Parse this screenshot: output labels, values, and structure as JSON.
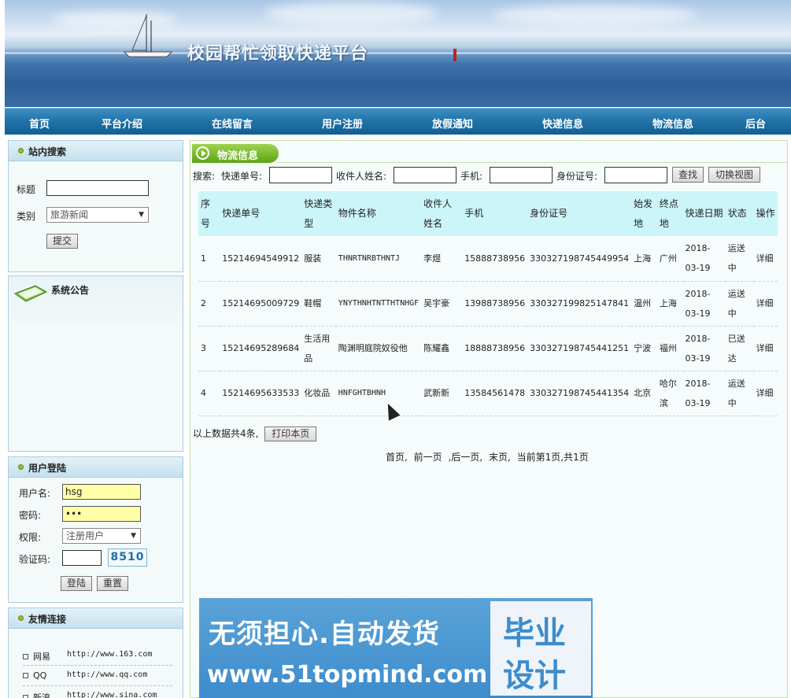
{
  "banner": {
    "title": "校园帮忙领取快递平台"
  },
  "nav": {
    "items": [
      "首页",
      "平台介绍",
      "在线留言",
      "用户注册",
      "放假通知",
      "快递信息",
      "物流信息",
      "后台"
    ]
  },
  "site_search": {
    "title": "站内搜索",
    "title_label": "标题",
    "title_value": "",
    "category_label": "类别",
    "category_value": "旅游新闻",
    "submit_label": "提交"
  },
  "announcement": {
    "title": "系统公告"
  },
  "login": {
    "title": "用户登陆",
    "username_label": "用户名:",
    "username_value": "hsg",
    "password_label": "密码:",
    "password_value": "•••",
    "role_label": "权限:",
    "role_value": "注册用户",
    "captcha_label": "验证码:",
    "captcha_value": "",
    "captcha_code": "8510",
    "login_button": "登陆",
    "reset_button": "重置"
  },
  "links": {
    "title": "友情连接",
    "items": [
      {
        "name": "网易",
        "url": "http://www.163.com"
      },
      {
        "name": "QQ",
        "url": "http://www.qq.com"
      },
      {
        "name": "新浪",
        "url": "http://www.sina.com"
      }
    ]
  },
  "main": {
    "title": "物流信息",
    "search": {
      "prefix": "搜索:",
      "tracking_label": "快递单号:",
      "recipient_label": "收件人姓名:",
      "phone_label": "手机:",
      "idcard_label": "身份证号:",
      "find_button": "查找",
      "switch_button": "切换视图"
    },
    "table": {
      "headers": [
        "序号",
        "快递单号",
        "快递类型",
        "物件名称",
        "收件人姓名",
        "手机",
        "身份证号",
        "始发地",
        "终点地",
        "快递日期",
        "状态",
        "操作"
      ],
      "rows": [
        [
          "1",
          "15214694549912",
          "服装",
          "THNRTNRBTHNTJ",
          "李煜",
          "15888738956",
          "330327198745449954",
          "上海",
          "广州",
          "2018-03-19",
          "运送中",
          "详细"
        ],
        [
          "2",
          "15214695009729",
          "鞋帽",
          "YNYTHNHTNTTHTNHGF",
          "吴宇豪",
          "13988738956",
          "330327199825147841",
          "温州",
          "上海",
          "2018-03-19",
          "运送中",
          "详细"
        ],
        [
          "3",
          "15214695289684",
          "生活用品",
          "陶渊明庭院奴役他",
          "陈耀鑫",
          "18888738956",
          "330327198745441251",
          "宁波",
          "福州",
          "2018-03-19",
          "已送达",
          "详细"
        ],
        [
          "4",
          "15214695633533",
          "化妆品",
          "HNFGHTBHNH",
          "武新新",
          "13584561478",
          "330327198745441354",
          "北京",
          "哈尔滨",
          "2018-03-19",
          "运送中",
          "详细"
        ]
      ]
    },
    "total_text": "以上数据共4条,",
    "print_button": "打印本页",
    "pager": {
      "first": "首页,",
      "prev": "前一页",
      "next": ",后一页,",
      "last": "末页,",
      "info": "当前第1页,共1页"
    }
  },
  "ad": {
    "slogan": "无须担心.自动发货",
    "url": "www.51topmind.com",
    "box_line1": "毕业",
    "box_line2": "设计"
  }
}
